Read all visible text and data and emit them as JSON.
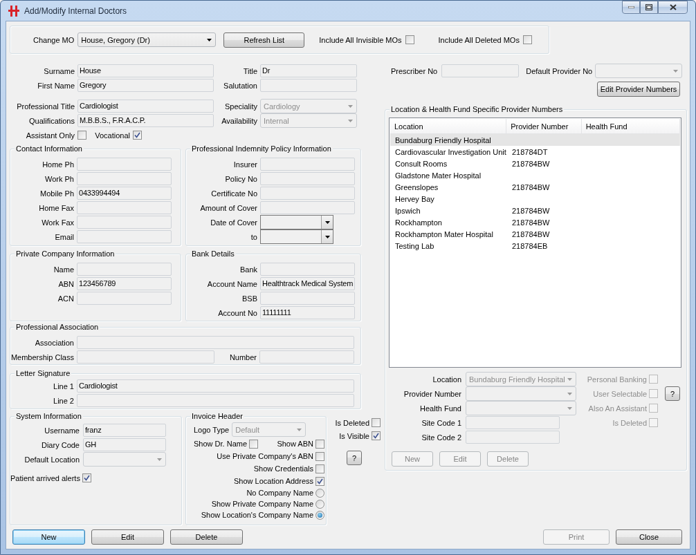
{
  "window": {
    "title": "Add/Modify Internal Doctors"
  },
  "header": {
    "change_mo": {
      "label": "Change MO",
      "value": "House, Gregory (Dr)",
      "disabled": false
    },
    "refresh_button": {
      "label": "Refresh List"
    },
    "filters": [
      {
        "label": "Include All Invisible MOs",
        "checked": false
      },
      {
        "label": "Include All Deleted MOs",
        "checked": false
      }
    ]
  },
  "identity": [
    [
      {
        "kind": "text",
        "label": "Surname",
        "value": "House"
      },
      {
        "kind": "text",
        "label": "Title",
        "value": "Dr"
      }
    ],
    [
      {
        "kind": "text",
        "label": "First Name",
        "value": "Gregory"
      },
      {
        "kind": "text",
        "label": "Salutation"
      }
    ]
  ],
  "professional": [
    [
      {
        "kind": "text",
        "label": "Professional Title",
        "value": "Cardiologist"
      },
      {
        "kind": "combo",
        "label": "Speciality",
        "value": "Cardiology",
        "disabled": true
      }
    ],
    [
      {
        "kind": "text",
        "label": "Qualifications",
        "value": "M.B.B.S., F.R.A.C.P."
      },
      {
        "kind": "combo",
        "label": "Availability",
        "value": "Internal",
        "disabled": true
      }
    ],
    [
      {
        "kind": "check",
        "label": "Assistant Only",
        "checked": false
      },
      {
        "kind": "check",
        "label": "Vocational",
        "checked": true
      }
    ]
  ],
  "contact": {
    "title": "Contact Information",
    "fields": [
      {
        "kind": "text",
        "label": "Home Ph"
      },
      {
        "kind": "text",
        "label": "Work Ph"
      },
      {
        "kind": "text",
        "label": "Mobile Ph",
        "value": "0433994494"
      },
      {
        "kind": "text",
        "label": "Home Fax"
      },
      {
        "kind": "text",
        "label": "Work Fax"
      },
      {
        "kind": "text",
        "label": "Email"
      }
    ]
  },
  "indemnity": {
    "title": "Professional Indemnity Policy Information",
    "fields": [
      {
        "kind": "text",
        "label": "Insurer"
      },
      {
        "kind": "text",
        "label": "Policy No"
      },
      {
        "kind": "text",
        "label": "Certificate No"
      },
      {
        "kind": "text",
        "label": "Amount of Cover"
      },
      {
        "kind": "date",
        "label": "Date of Cover"
      },
      {
        "kind": "date",
        "label": "to"
      }
    ]
  },
  "private_company": {
    "title": "Private Company Information",
    "fields": [
      {
        "kind": "text",
        "label": "Name"
      },
      {
        "kind": "text",
        "label": "ABN",
        "value": "123456789"
      },
      {
        "kind": "text",
        "label": "ACN"
      }
    ]
  },
  "bank": {
    "title": "Bank Details",
    "fields": [
      {
        "kind": "text",
        "label": "Bank"
      },
      {
        "kind": "text",
        "label": "Account Name",
        "value": "Healthtrack Medical System"
      },
      {
        "kind": "text",
        "label": "BSB"
      },
      {
        "kind": "text",
        "label": "Account No",
        "value": "11111111"
      }
    ]
  },
  "association": {
    "title": "Professional Association",
    "rows": [
      [
        {
          "kind": "text",
          "label": "Association"
        }
      ],
      [
        {
          "kind": "text",
          "label": "Membership Class"
        },
        {
          "kind": "text",
          "label": "Number"
        }
      ]
    ]
  },
  "letter_signature": {
    "title": "Letter Signature",
    "fields": [
      {
        "kind": "text",
        "label": "Line 1",
        "value": "Cardiologist"
      },
      {
        "kind": "text",
        "label": "Line 2"
      }
    ]
  },
  "system": {
    "title": "System Information",
    "fields": [
      {
        "kind": "text",
        "label": "Username",
        "value": "franz"
      },
      {
        "kind": "text",
        "label": "Diary Code",
        "value": "GH"
      },
      {
        "kind": "combo",
        "label": "Default Location",
        "disabled": true
      },
      {
        "kind": "check",
        "label": "Patient arrived alerts",
        "checked": true
      }
    ]
  },
  "invoice_header": {
    "title": "Invoice Header",
    "logo_type": {
      "label": "Logo Type",
      "value": "Default",
      "disabled": true
    },
    "option_rows": [
      [
        {
          "label": "Show Dr. Name",
          "checked": false
        },
        {
          "label": "Show ABN",
          "checked": false
        }
      ],
      [
        {
          "label": "Use Private Company's ABN",
          "checked": false
        }
      ],
      [
        {
          "label": "Show Credentials",
          "checked": false
        }
      ],
      [
        {
          "label": "Show Location Address",
          "checked": true
        }
      ]
    ],
    "company_name": [
      {
        "label": "No Company Name",
        "selected": false
      },
      {
        "label": "Show Private Company Name",
        "selected": false
      },
      {
        "label": "Show Location's Company Name",
        "selected": true
      }
    ]
  },
  "status": {
    "checks": [
      {
        "label": "Is Deleted",
        "checked": false
      },
      {
        "label": "Is Visible",
        "checked": true
      }
    ],
    "help_button": "?"
  },
  "actions": [
    {
      "label": "New",
      "focused": true,
      "disabled": false
    },
    {
      "label": "Edit",
      "focused": false,
      "disabled": false
    },
    {
      "label": "Delete",
      "focused": false,
      "disabled": false
    }
  ],
  "provider": {
    "prescriber_no": {
      "label": "Prescriber No"
    },
    "default_provider_no": {
      "label": "Default Provider No",
      "disabled": true
    },
    "edit_button": {
      "label": "Edit Provider Numbers"
    }
  },
  "provider_numbers": {
    "title": "Location & Health Fund Specific Provider Numbers",
    "table": {
      "columns": [
        "Location",
        "Provider Number",
        "Health Fund"
      ],
      "rows": [
        {
          "location": "Bundaburg Friendly Hospital",
          "selected": true
        },
        {
          "location": "Cardiovascular Investigation Unit",
          "provider_number": "218784DT",
          "selected": false
        },
        {
          "location": "Consult Rooms",
          "provider_number": "218784BW",
          "selected": false
        },
        {
          "location": "Gladstone Mater Hospital",
          "selected": false
        },
        {
          "location": "Greenslopes",
          "provider_number": "218784BW",
          "selected": false
        },
        {
          "location": "Hervey Bay",
          "selected": false
        },
        {
          "location": "Ipswich",
          "provider_number": "218784BW",
          "selected": false
        },
        {
          "location": "Rockhampton",
          "provider_number": "218784BW",
          "selected": false
        },
        {
          "location": "Rockhampton Mater Hospital",
          "provider_number": "218784BW",
          "selected": false
        },
        {
          "location": "Testing Lab",
          "provider_number": "218784EB",
          "selected": false
        }
      ]
    },
    "fields": [
      {
        "kind": "combo",
        "label": "Location",
        "value": "Bundaburg Friendly Hospital",
        "disabled": true
      },
      {
        "kind": "combo",
        "label": "Provider Number",
        "disabled": true
      },
      {
        "kind": "combo",
        "label": "Health Fund",
        "disabled": true
      },
      {
        "kind": "text",
        "label": "Site Code 1"
      },
      {
        "kind": "text",
        "label": "Site Code 2"
      }
    ],
    "flags": [
      {
        "label": "Personal Banking",
        "checked": false,
        "disabled": true
      },
      {
        "label": "User Selectable",
        "checked": false,
        "disabled": true
      },
      {
        "label": "Also An Assistant",
        "checked": false,
        "disabled": true
      },
      {
        "label": "Is Deleted",
        "checked": false,
        "disabled": true
      }
    ],
    "help_button": "?",
    "buttons": [
      {
        "label": "New",
        "disabled": true
      },
      {
        "label": "Edit",
        "disabled": true
      },
      {
        "label": "Delete",
        "disabled": true
      }
    ]
  },
  "footer_buttons": [
    {
      "label": "Print",
      "disabled": true
    },
    {
      "label": "Close",
      "disabled": false
    }
  ]
}
